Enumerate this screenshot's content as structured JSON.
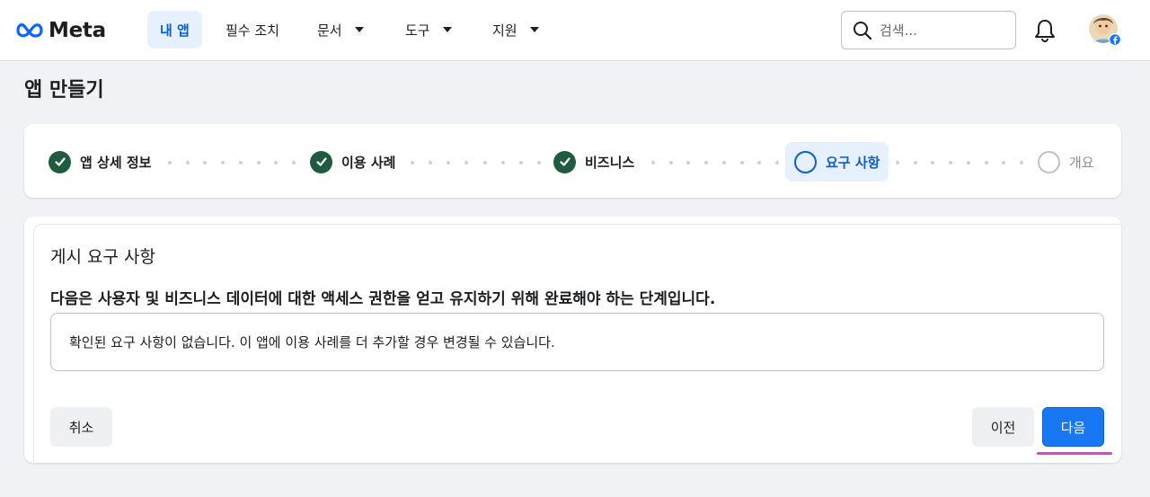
{
  "nav": {
    "logo_text": "Meta",
    "items": [
      {
        "label": "내 앱",
        "active": true,
        "has_dropdown": false
      },
      {
        "label": "필수 조치",
        "active": false,
        "has_dropdown": false
      },
      {
        "label": "문서",
        "active": false,
        "has_dropdown": true
      },
      {
        "label": "도구",
        "active": false,
        "has_dropdown": true
      },
      {
        "label": "지원",
        "active": false,
        "has_dropdown": true
      }
    ],
    "search_placeholder": "검색...",
    "icons": {
      "search": "search-icon",
      "notifications": "bell-icon",
      "profile": "avatar",
      "badge": "facebook-badge-icon"
    }
  },
  "page": {
    "title": "앱 만들기"
  },
  "stepper": {
    "steps": [
      {
        "label": "앱 상세 정보",
        "status": "complete"
      },
      {
        "label": "이용 사례",
        "status": "complete"
      },
      {
        "label": "비즈니스",
        "status": "complete"
      },
      {
        "label": "요구 사항",
        "status": "current"
      },
      {
        "label": "개요",
        "status": "pending"
      }
    ]
  },
  "requirements": {
    "title": "게시 요구 사항",
    "description": "다음은 사용자 및 비즈니스 데이터에 대한 액세스 권한을 얻고 유지하기 위해 완료해야 하는 단계입니다.",
    "notice": "확인된 요구 사항이 없습니다. 이 앱에 이용 사례를 더 추가할 경우 변경될 수 있습니다."
  },
  "actions": {
    "cancel": "취소",
    "previous": "이전",
    "next": "다음"
  },
  "colors": {
    "accent": "#1877f2",
    "active_bg": "#e7f0fd",
    "complete": "#1f5c3f",
    "annotation": "#e53ed9"
  }
}
